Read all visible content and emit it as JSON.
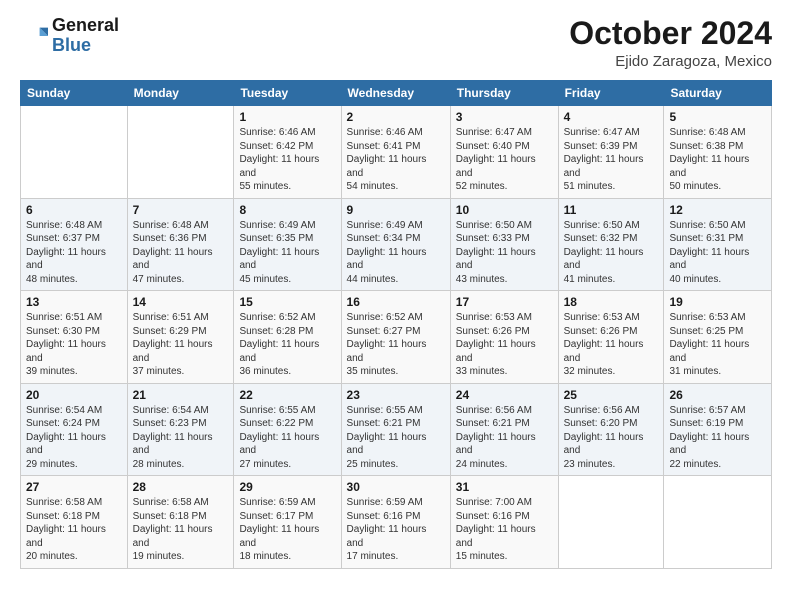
{
  "header": {
    "logo": {
      "general": "General",
      "blue": "Blue"
    },
    "title": "October 2024",
    "location": "Ejido Zaragoza, Mexico"
  },
  "calendar": {
    "days_of_week": [
      "Sunday",
      "Monday",
      "Tuesday",
      "Wednesday",
      "Thursday",
      "Friday",
      "Saturday"
    ],
    "weeks": [
      [
        {
          "day": "",
          "info": ""
        },
        {
          "day": "",
          "info": ""
        },
        {
          "day": "1",
          "info": "Sunrise: 6:46 AM\nSunset: 6:42 PM\nDaylight: 11 hours and 55 minutes."
        },
        {
          "day": "2",
          "info": "Sunrise: 6:46 AM\nSunset: 6:41 PM\nDaylight: 11 hours and 54 minutes."
        },
        {
          "day": "3",
          "info": "Sunrise: 6:47 AM\nSunset: 6:40 PM\nDaylight: 11 hours and 52 minutes."
        },
        {
          "day": "4",
          "info": "Sunrise: 6:47 AM\nSunset: 6:39 PM\nDaylight: 11 hours and 51 minutes."
        },
        {
          "day": "5",
          "info": "Sunrise: 6:48 AM\nSunset: 6:38 PM\nDaylight: 11 hours and 50 minutes."
        }
      ],
      [
        {
          "day": "6",
          "info": "Sunrise: 6:48 AM\nSunset: 6:37 PM\nDaylight: 11 hours and 48 minutes."
        },
        {
          "day": "7",
          "info": "Sunrise: 6:48 AM\nSunset: 6:36 PM\nDaylight: 11 hours and 47 minutes."
        },
        {
          "day": "8",
          "info": "Sunrise: 6:49 AM\nSunset: 6:35 PM\nDaylight: 11 hours and 45 minutes."
        },
        {
          "day": "9",
          "info": "Sunrise: 6:49 AM\nSunset: 6:34 PM\nDaylight: 11 hours and 44 minutes."
        },
        {
          "day": "10",
          "info": "Sunrise: 6:50 AM\nSunset: 6:33 PM\nDaylight: 11 hours and 43 minutes."
        },
        {
          "day": "11",
          "info": "Sunrise: 6:50 AM\nSunset: 6:32 PM\nDaylight: 11 hours and 41 minutes."
        },
        {
          "day": "12",
          "info": "Sunrise: 6:50 AM\nSunset: 6:31 PM\nDaylight: 11 hours and 40 minutes."
        }
      ],
      [
        {
          "day": "13",
          "info": "Sunrise: 6:51 AM\nSunset: 6:30 PM\nDaylight: 11 hours and 39 minutes."
        },
        {
          "day": "14",
          "info": "Sunrise: 6:51 AM\nSunset: 6:29 PM\nDaylight: 11 hours and 37 minutes."
        },
        {
          "day": "15",
          "info": "Sunrise: 6:52 AM\nSunset: 6:28 PM\nDaylight: 11 hours and 36 minutes."
        },
        {
          "day": "16",
          "info": "Sunrise: 6:52 AM\nSunset: 6:27 PM\nDaylight: 11 hours and 35 minutes."
        },
        {
          "day": "17",
          "info": "Sunrise: 6:53 AM\nSunset: 6:26 PM\nDaylight: 11 hours and 33 minutes."
        },
        {
          "day": "18",
          "info": "Sunrise: 6:53 AM\nSunset: 6:26 PM\nDaylight: 11 hours and 32 minutes."
        },
        {
          "day": "19",
          "info": "Sunrise: 6:53 AM\nSunset: 6:25 PM\nDaylight: 11 hours and 31 minutes."
        }
      ],
      [
        {
          "day": "20",
          "info": "Sunrise: 6:54 AM\nSunset: 6:24 PM\nDaylight: 11 hours and 29 minutes."
        },
        {
          "day": "21",
          "info": "Sunrise: 6:54 AM\nSunset: 6:23 PM\nDaylight: 11 hours and 28 minutes."
        },
        {
          "day": "22",
          "info": "Sunrise: 6:55 AM\nSunset: 6:22 PM\nDaylight: 11 hours and 27 minutes."
        },
        {
          "day": "23",
          "info": "Sunrise: 6:55 AM\nSunset: 6:21 PM\nDaylight: 11 hours and 25 minutes."
        },
        {
          "day": "24",
          "info": "Sunrise: 6:56 AM\nSunset: 6:21 PM\nDaylight: 11 hours and 24 minutes."
        },
        {
          "day": "25",
          "info": "Sunrise: 6:56 AM\nSunset: 6:20 PM\nDaylight: 11 hours and 23 minutes."
        },
        {
          "day": "26",
          "info": "Sunrise: 6:57 AM\nSunset: 6:19 PM\nDaylight: 11 hours and 22 minutes."
        }
      ],
      [
        {
          "day": "27",
          "info": "Sunrise: 6:58 AM\nSunset: 6:18 PM\nDaylight: 11 hours and 20 minutes."
        },
        {
          "day": "28",
          "info": "Sunrise: 6:58 AM\nSunset: 6:18 PM\nDaylight: 11 hours and 19 minutes."
        },
        {
          "day": "29",
          "info": "Sunrise: 6:59 AM\nSunset: 6:17 PM\nDaylight: 11 hours and 18 minutes."
        },
        {
          "day": "30",
          "info": "Sunrise: 6:59 AM\nSunset: 6:16 PM\nDaylight: 11 hours and 17 minutes."
        },
        {
          "day": "31",
          "info": "Sunrise: 7:00 AM\nSunset: 6:16 PM\nDaylight: 11 hours and 15 minutes."
        },
        {
          "day": "",
          "info": ""
        },
        {
          "day": "",
          "info": ""
        }
      ]
    ]
  }
}
